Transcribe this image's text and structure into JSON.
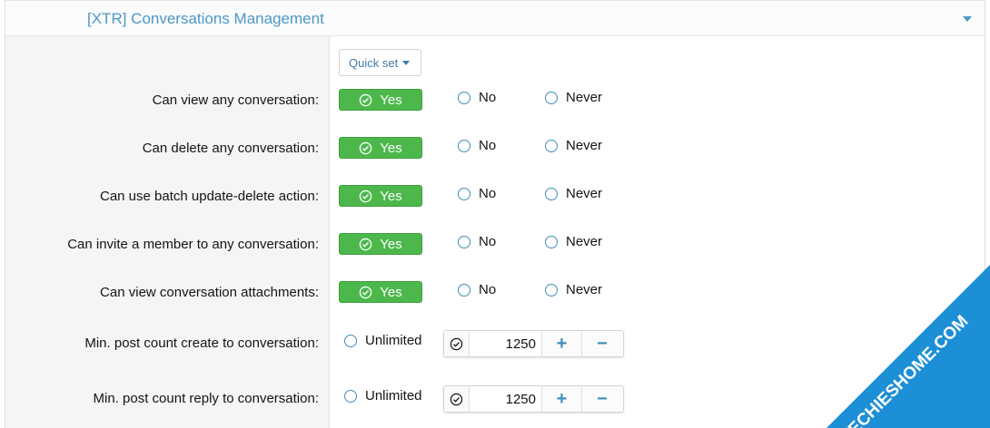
{
  "section": {
    "title": "[XTR] Conversations Management",
    "toggle_icon": "caret-down-icon"
  },
  "quick_set": {
    "label": "Quick set"
  },
  "permissions": [
    {
      "label": "Can view any conversation:",
      "selected": "Yes",
      "yes": "Yes",
      "no": "No",
      "never": "Never"
    },
    {
      "label": "Can delete any conversation:",
      "selected": "Yes",
      "yes": "Yes",
      "no": "No",
      "never": "Never"
    },
    {
      "label": "Can use batch update-delete action:",
      "selected": "Yes",
      "yes": "Yes",
      "no": "No",
      "never": "Never"
    },
    {
      "label": "Can invite a member to any conversation:",
      "selected": "Yes",
      "yes": "Yes",
      "no": "No",
      "never": "Never"
    },
    {
      "label": "Can view conversation attachments:",
      "selected": "Yes",
      "yes": "Yes",
      "no": "No",
      "never": "Never"
    }
  ],
  "counts": [
    {
      "label": "Min. post count create to conversation:",
      "unlimited": "Unlimited",
      "value": "1250",
      "plus": "+",
      "minus": "−"
    },
    {
      "label": "Min. post count reply to conversation:",
      "unlimited": "Unlimited",
      "value": "1250",
      "plus": "+",
      "minus": "−"
    }
  ],
  "watermark": {
    "text": "TECHIESHOME.COM",
    "color": "#1d8fd6"
  },
  "colors": {
    "accent": "#4d97c8",
    "yes_green": "#4cb84c",
    "radio_blue": "#3d8fb8"
  }
}
